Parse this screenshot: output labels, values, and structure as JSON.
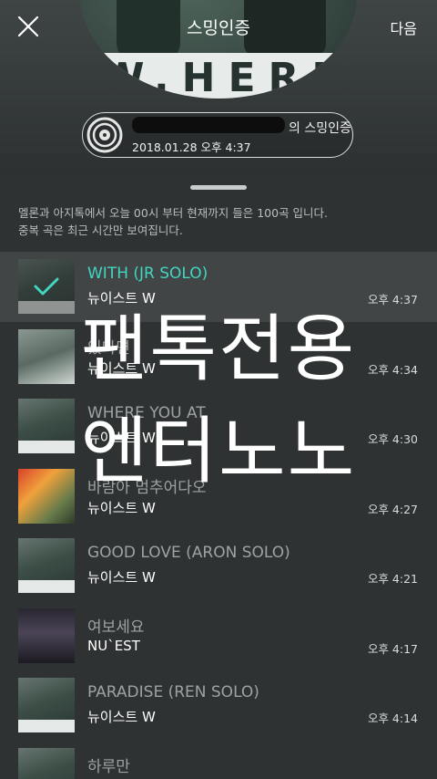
{
  "header": {
    "title": "스밍인증",
    "next_label": "다음",
    "album_wordmark": "W.HERE"
  },
  "auth": {
    "title_suffix": "의 스밍인증",
    "date": "2018.01.28 오후 4:37"
  },
  "notice": {
    "line1": "멜론과 아지톡에서 오늘 00시 부터 현재까지 들은 100곡 입니다.",
    "line2": "중복 곡은 최근 시간만 보여집니다."
  },
  "songs": [
    {
      "title": "WITH (JR SOLO)",
      "artist": "뉴이스트 W",
      "time": "오후 4:37",
      "art": "where",
      "selected": true
    },
    {
      "title": "있다면",
      "artist": "뉴이스트 W",
      "time": "오후 4:34",
      "art": "where2",
      "selected": false
    },
    {
      "title": "WHERE YOU AT",
      "artist": "뉴이스트 W",
      "time": "오후 4:30",
      "art": "where",
      "selected": false
    },
    {
      "title": "바람아 멈추어다오",
      "artist": "뉴이스트 W",
      "time": "오후 4:27",
      "art": "drama",
      "selected": false
    },
    {
      "title": "GOOD LOVE (ARON SOLO)",
      "artist": "뉴이스트 W",
      "time": "오후 4:21",
      "art": "where",
      "selected": false
    },
    {
      "title": "여보세요",
      "artist": "NU`EST",
      "time": "오후 4:17",
      "art": "group",
      "selected": false
    },
    {
      "title": "PARADISE (REN SOLO)",
      "artist": "뉴이스트 W",
      "time": "오후 4:14",
      "art": "where",
      "selected": false
    },
    {
      "title": "하루만",
      "artist": "",
      "time": "",
      "art": "where",
      "selected": false
    }
  ],
  "watermark": {
    "line1": "팬톡전용",
    "line2": "엔터노노"
  },
  "icons": {
    "close": "close-icon",
    "disc": "disc-icon",
    "check": "check-icon"
  },
  "colors": {
    "accent": "#42d6c2",
    "background": "#2e3232",
    "selected_row": "#414545"
  }
}
